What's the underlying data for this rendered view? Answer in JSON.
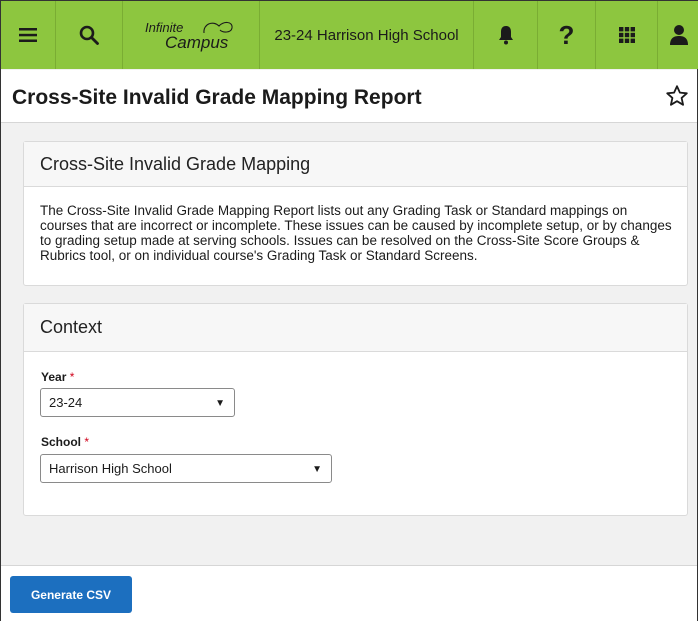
{
  "topbar": {
    "logo_line1": "Infinite",
    "logo_line2": "Campus",
    "school_context": "23-24 Harrison High School",
    "help_glyph": "?",
    "icons": [
      "menu-icon",
      "search-icon",
      "bell-icon",
      "help-icon",
      "apps-grid-icon",
      "user-icon"
    ]
  },
  "header": {
    "title": "Cross-Site Invalid Grade Mapping Report"
  },
  "info_card": {
    "title": "Cross-Site Invalid Grade Mapping",
    "description": "The Cross-Site Invalid Grade Mapping Report lists out any Grading Task or Standard mappings on courses that are incorrect or incomplete. These issues can be caused by incomplete setup, or by changes to grading setup made at serving schools. Issues can be resolved on the Cross-Site Score Groups & Rubrics tool, or on individual course's Grading Task or Standard Screens."
  },
  "context": {
    "title": "Context",
    "year_label": "Year",
    "year_value": "23-24",
    "school_label": "School",
    "school_value": "Harrison High School",
    "required_mark": "*"
  },
  "footer": {
    "generate_label": "Generate CSV"
  },
  "colors": {
    "brand_green": "#8dc63f",
    "primary_button": "#1c6fbf",
    "required": "#d0021b"
  }
}
